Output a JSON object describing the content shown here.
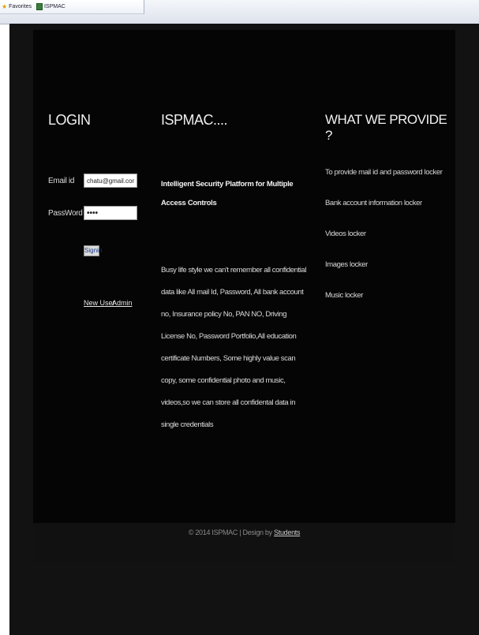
{
  "browser": {
    "favorites_label": "Favorites",
    "tab_label": "ISPMAC"
  },
  "login": {
    "title": "LOGIN",
    "email_label": "Email id",
    "email_value": "chatu@gmail.com",
    "password_label": "PassWord",
    "password_value": "••••",
    "signin_label": "Signin",
    "new_user_label": "New User",
    "admin_label": "Admin"
  },
  "about": {
    "title": "ISPMAC....",
    "heading": "Intelligent Security Platform for Multiple Access Controls",
    "body": "Busy life style we can't remember all confidential data like All mail Id, Password, All bank account no, Insurance policy No, PAN NO, Driving License No, Password Portfolio,All education certificate Numbers, Some highly value scan copy, some confidential photo and music, videos,so we can store all confidental data in single credentials"
  },
  "provide": {
    "title": "WHAT WE PROVIDE ?",
    "items": [
      "To provide mail id and password locker",
      "Bank account information locker",
      "Videos locker",
      "Images locker",
      "Music locker"
    ]
  },
  "footer": {
    "copyright": "© 2014 ISPMAC | Design by",
    "link_label": "Students"
  }
}
